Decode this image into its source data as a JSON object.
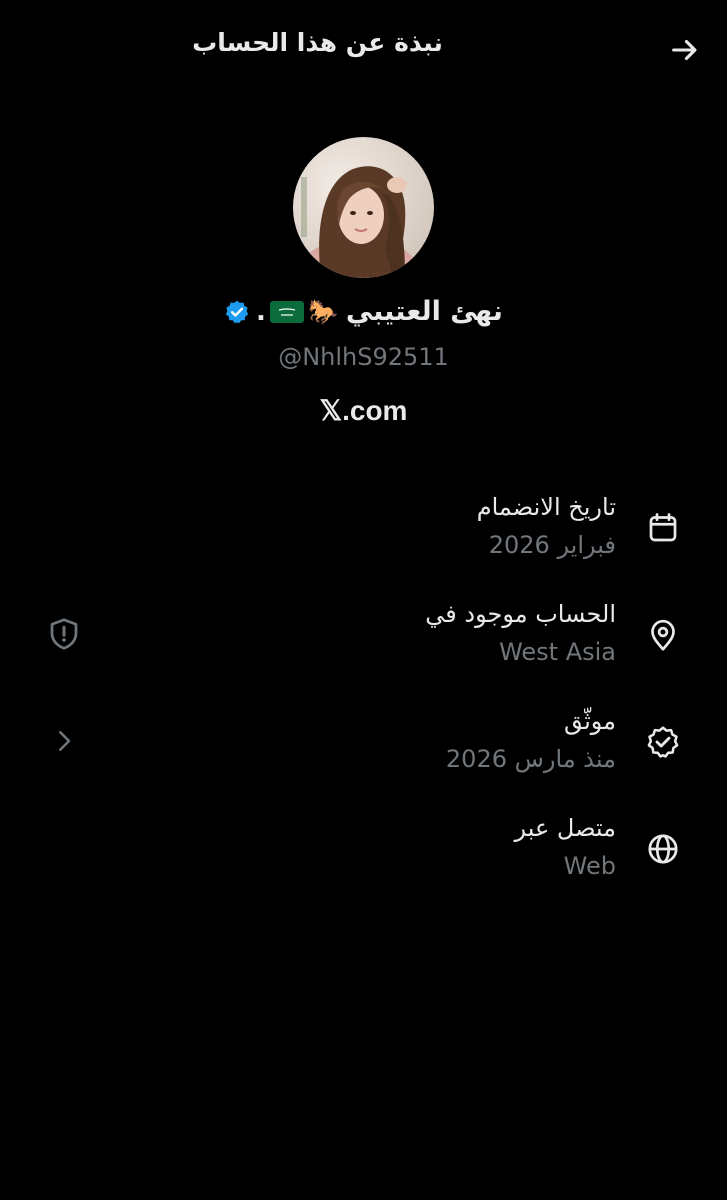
{
  "header": {
    "title": "نبذة عن هذا الحساب",
    "back_icon": "arrow-right-icon"
  },
  "profile": {
    "display_name": "نهئ العتيبي",
    "emoji_suffix": "🐎",
    "dot": ".",
    "flag_icon": "saudi-flag-icon",
    "verified_icon": "verified-badge-icon",
    "verified_color": "#1d9bf0",
    "handle": "@NhlhS92511",
    "site": "𝕏.com"
  },
  "info": {
    "joined": {
      "label": "تاريخ الانضمام",
      "value": "فبراير 2026",
      "icon": "calendar-icon"
    },
    "location": {
      "label": "الحساب موجود في",
      "value": "West Asia",
      "icon": "location-pin-icon"
    },
    "verified": {
      "label": "موثّق",
      "value": "منذ مارس 2026",
      "icon": "verified-check-icon"
    },
    "connected": {
      "label": "متصل عبر",
      "value": "Web",
      "icon": "globe-icon"
    }
  },
  "side_actions": {
    "shield_icon": "shield-alert-icon",
    "chevron_icon": "chevron-right-icon"
  },
  "colors": {
    "background": "#000000",
    "text_primary": "#e7e9ea",
    "text_secondary": "#71767b",
    "accent": "#1d9bf0"
  }
}
